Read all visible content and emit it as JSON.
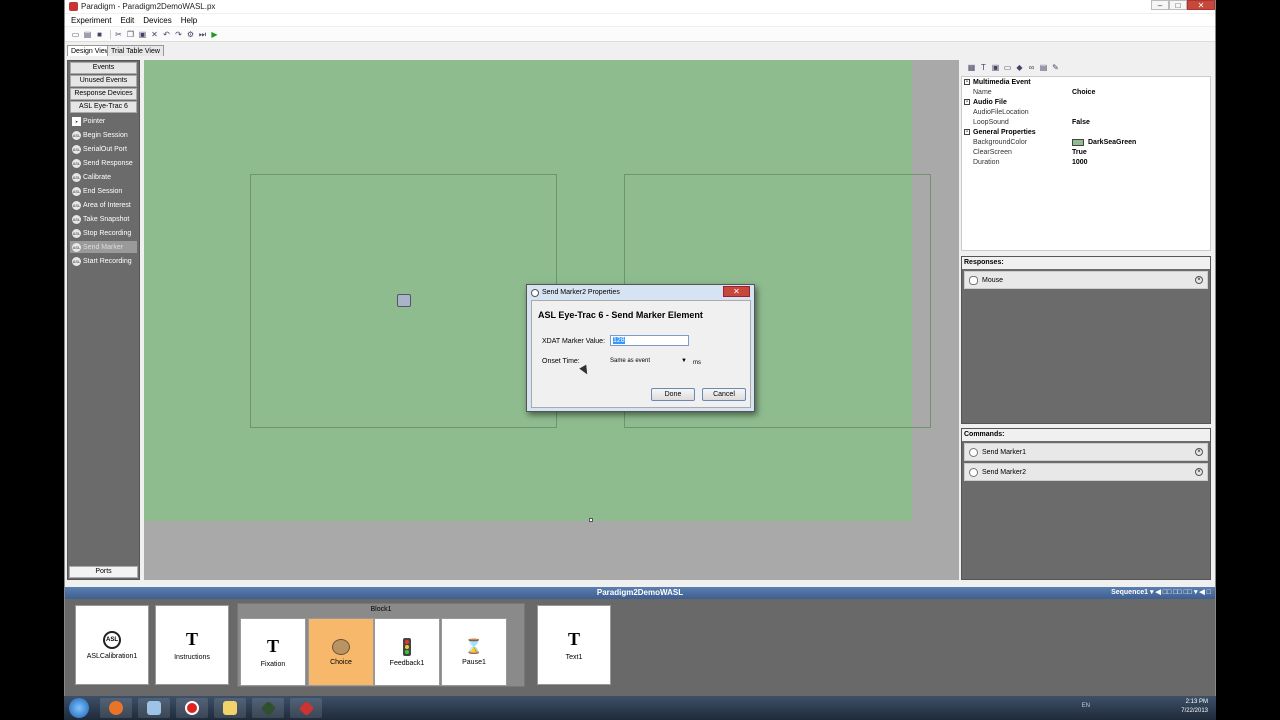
{
  "window": {
    "title": "Paradigm - Paradigm2DemoWASL.px",
    "controls": {
      "minimize": "–",
      "maximize": "□",
      "close": "✕"
    }
  },
  "menu": [
    "Experiment",
    "Edit",
    "Devices",
    "Help"
  ],
  "tabs": [
    {
      "label": "Design View",
      "active": true
    },
    {
      "label": "Trial Table View",
      "active": false
    }
  ],
  "sidebar": {
    "headers": [
      "Events",
      "Unused Events",
      "Response Devices",
      "ASL Eye-Trac 6"
    ],
    "items": [
      {
        "label": "Pointer",
        "icon": "pointer-icon"
      },
      {
        "label": "Begin Session",
        "icon": "asl-icon"
      },
      {
        "label": "SerialOut Port",
        "icon": "asl-icon"
      },
      {
        "label": "Send Response",
        "icon": "asl-icon"
      },
      {
        "label": "Calibrate",
        "icon": "asl-icon"
      },
      {
        "label": "End Session",
        "icon": "asl-icon"
      },
      {
        "label": "Area of Interest",
        "icon": "asl-icon"
      },
      {
        "label": "Take Snapshot",
        "icon": "asl-icon"
      },
      {
        "label": "Stop Recording",
        "icon": "asl-icon"
      },
      {
        "label": "Send Marker",
        "icon": "asl-icon",
        "selected": true
      },
      {
        "label": "Start Recording",
        "icon": "asl-icon"
      }
    ],
    "footer": "Ports"
  },
  "properties": {
    "categories": [
      {
        "name": "Multimedia Event",
        "rows": [
          {
            "key": "Name",
            "value": "Choice"
          }
        ]
      },
      {
        "name": "Audio File",
        "rows": [
          {
            "key": "AudioFileLocation",
            "value": ""
          },
          {
            "key": "LoopSound",
            "value": "False"
          }
        ]
      },
      {
        "name": "General Properties",
        "rows": [
          {
            "key": "BackgroundColor",
            "value": "DarkSeaGreen"
          },
          {
            "key": "ClearScreen",
            "value": "True"
          },
          {
            "key": "Duration",
            "value": "1000"
          }
        ]
      }
    ]
  },
  "responses": {
    "title": "Responses:",
    "items": [
      "Mouse"
    ]
  },
  "commands": {
    "title": "Commands:",
    "items": [
      "Send Marker1",
      "Send Marker2"
    ]
  },
  "sequence": {
    "title": "Paradigm2DemoWASL",
    "selector": "Sequence1",
    "block_title": "Block1",
    "cards_before": [
      {
        "label": "ASLCalibration1",
        "icon": "ASL"
      },
      {
        "label": "Instructions",
        "icon": "T"
      }
    ],
    "block_cards": [
      {
        "label": "Fixation",
        "icon": "T"
      },
      {
        "label": "Choice",
        "icon": "palette",
        "selected": true
      },
      {
        "label": "Feedback1",
        "icon": "traffic-light"
      },
      {
        "label": "Pause1",
        "icon": "hourglass"
      }
    ],
    "cards_after": [
      {
        "label": "Text1",
        "icon": "T"
      }
    ]
  },
  "dialog": {
    "title": "Send Marker2 Properties",
    "heading": "ASL Eye-Trac 6 - Send Marker Element",
    "marker_label": "XDAT Marker Value:",
    "marker_value": "128",
    "onset_label": "Onset Time:",
    "onset_value": "Same as event",
    "onset_unit": "ms",
    "done": "Done",
    "cancel": "Cancel"
  },
  "taskbar": {
    "lang": "EN",
    "time": "2:13 PM",
    "date": "7/22/2013"
  },
  "colors": {
    "stage": "#8fbc8f",
    "selected_card": "#f7b86b",
    "sequence_bar": "#4a6fa0"
  }
}
